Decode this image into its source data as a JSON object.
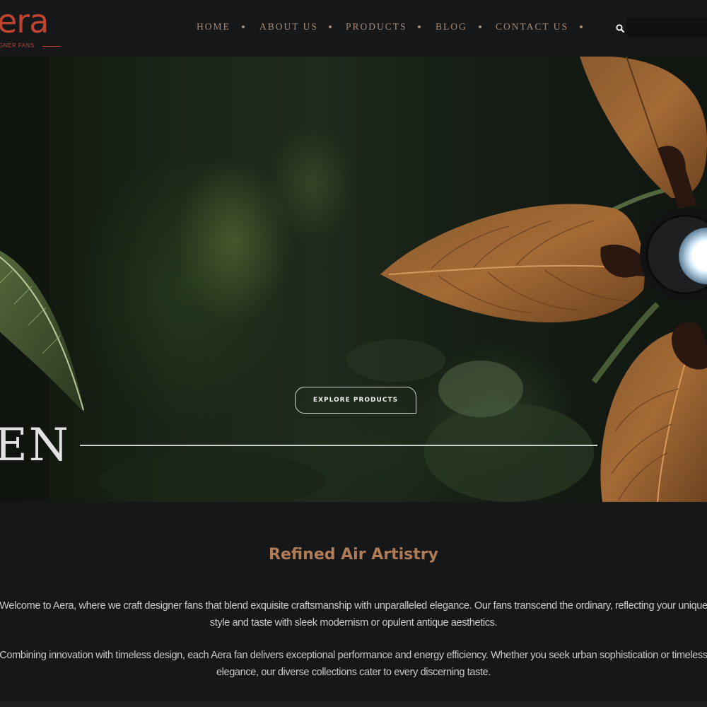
{
  "brand": {
    "name": "era",
    "tagline": "GNER FANS",
    "color": "#c0432f"
  },
  "nav": {
    "items": [
      {
        "label": "HOME"
      },
      {
        "label": "ABOUT US"
      },
      {
        "label": "PRODUCTS"
      },
      {
        "label": "BLOG"
      },
      {
        "label": "CONTACT US"
      }
    ],
    "color": "#a9896e"
  },
  "search": {
    "placeholder": "",
    "icon": "search-icon"
  },
  "hero": {
    "title": "EN",
    "button_label": "EXPLORE PRODUCTS"
  },
  "intro": {
    "heading": "Refined Air Artistry",
    "heading_color": "#b07c56",
    "paragraph1": "Welcome to Aera, where we craft designer fans that blend exquisite craftsmanship with unparalleled elegance. Our fans transcend the ordinary, reflecting your unique style and taste with sleek modernism or opulent antique aesthetics.",
    "paragraph2": "Combining innovation with timeless design, each Aera fan delivers exceptional performance and energy efficiency. Whether you seek urban sophistication or timeless elegance, our diverse collections cater to every discerning taste."
  }
}
